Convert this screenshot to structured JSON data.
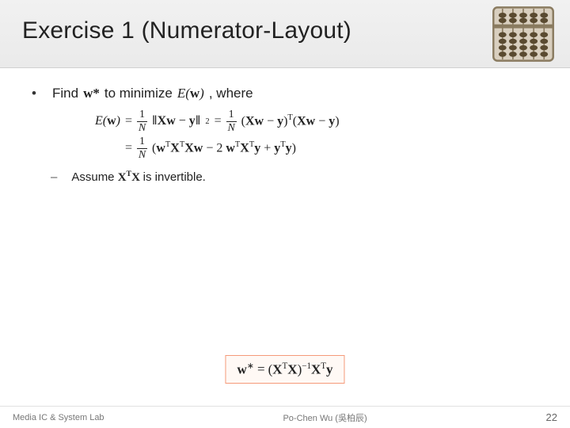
{
  "title": "Exercise 1 (Numerator-Layout)",
  "bullet": {
    "find": "Find",
    "w_star": "w*",
    "to_minimize": "to minimize",
    "E_of_w": "E(w)",
    "where": ", where"
  },
  "equation": {
    "lhs": "E(w)",
    "eq": "=",
    "one": "1",
    "N": "N",
    "norm_expr": "Xw − y",
    "sq": "2",
    "T": "T",
    "term_a": "Xw − y",
    "line2_expr": "wᵀXᵀXw − 2 wᵀXᵀy + yᵀy"
  },
  "assume": {
    "dash": "–",
    "label": "Assume",
    "matrix": "XᵀX",
    "tail": "is invertible."
  },
  "answer": {
    "lhs": "w*",
    "eq": "=",
    "rhs_open": "(",
    "rhs_a": "XᵀX",
    "rhs_close": ")",
    "inv": "−1",
    "rhs_b": "Xᵀy"
  },
  "footer": {
    "left": "Media IC & System Lab",
    "center": "Po-Chen Wu (吳柏辰)",
    "page": "22"
  }
}
